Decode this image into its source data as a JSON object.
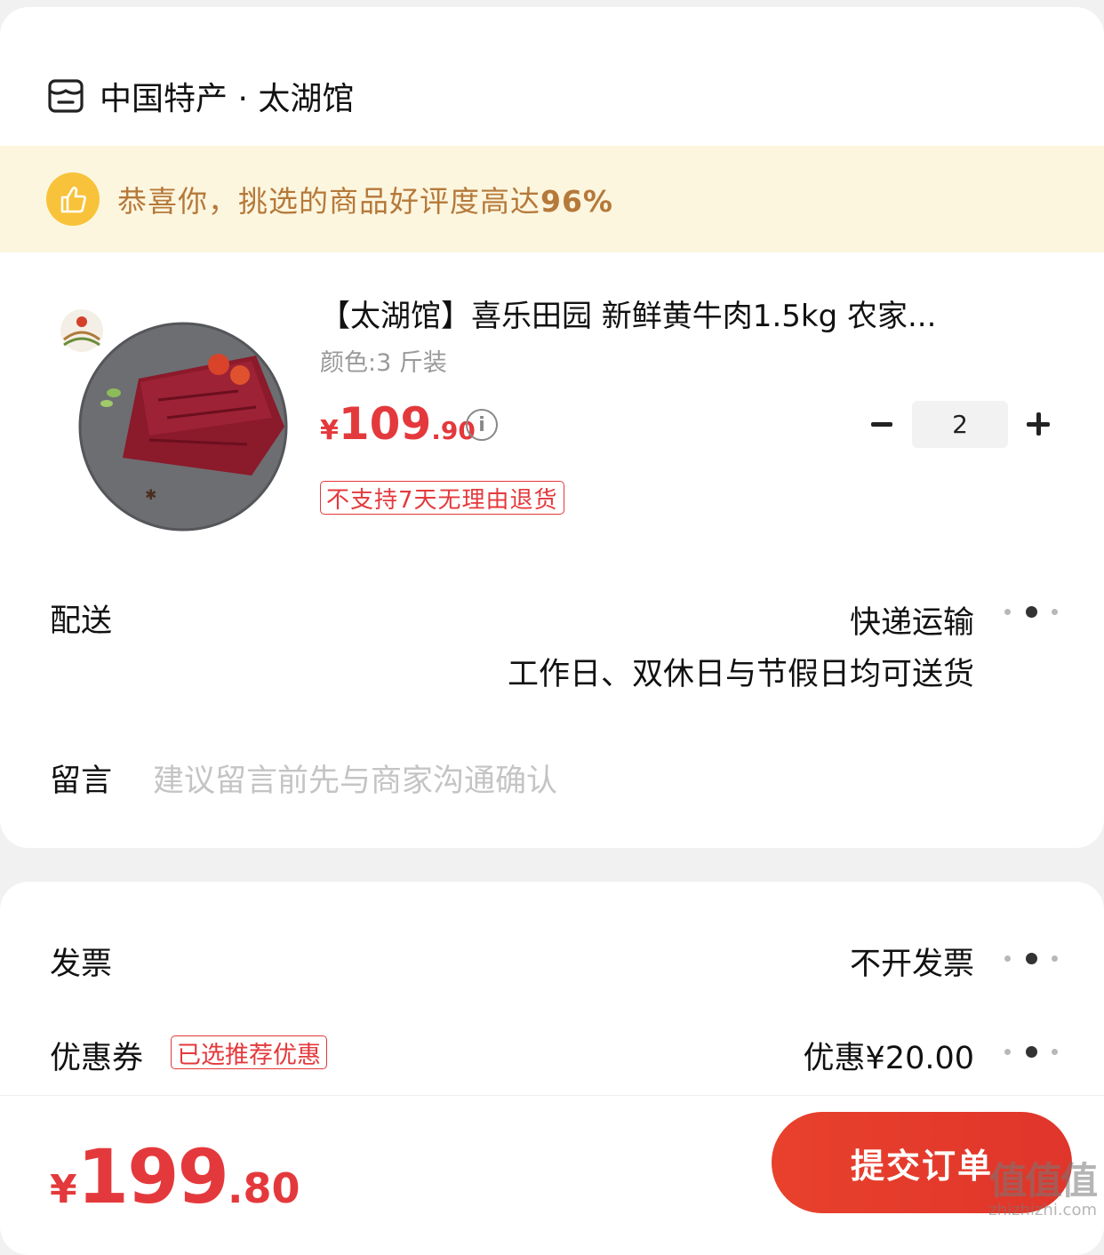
{
  "shop": {
    "name": "中国特产 · 太湖馆",
    "icon": "shop-icon"
  },
  "banner": {
    "text": "恭喜你，挑选的商品好评度高达",
    "rate": "96%",
    "icon": "thumbs-up-icon"
  },
  "product": {
    "title": "【太湖馆】喜乐田园 新鲜黄牛肉1.5kg 农家...",
    "variant": "颜色:3 斤装",
    "price": {
      "currency": "¥",
      "integer": "109",
      "decimal": ".90"
    },
    "quantity": "2",
    "return_tag": "不支持7天无理由退货"
  },
  "delivery": {
    "label": "配送",
    "method": "快递运输",
    "schedule": "工作日、双休日与节假日均可送货"
  },
  "note": {
    "label": "留言",
    "placeholder": "建议留言前先与商家沟通确认"
  },
  "invoice": {
    "label": "发票",
    "value": "不开发票"
  },
  "coupon": {
    "label": "优惠券",
    "tag": "已选推荐优惠",
    "value": "优惠¥20.00"
  },
  "footer": {
    "total": {
      "currency": "¥",
      "integer": "199",
      "decimal": ".80"
    },
    "submit_label": "提交订单"
  },
  "watermark": {
    "big": "值值值",
    "small": "zhizhizhi.com"
  },
  "colors": {
    "accent": "#e4393c",
    "banner_bg": "#fdf6df",
    "banner_text": "#b5793a"
  }
}
